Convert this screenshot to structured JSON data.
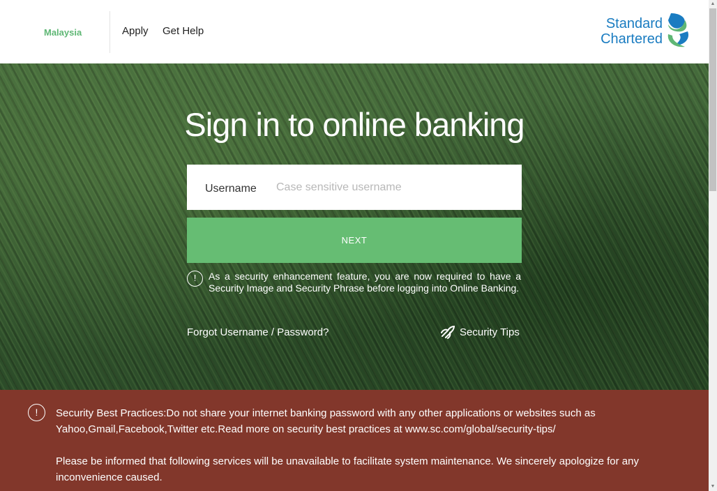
{
  "header": {
    "country": "Malaysia",
    "nav": {
      "apply": "Apply",
      "get_help": "Get Help"
    },
    "logo": {
      "line1": "Standard",
      "line2": "Chartered",
      "icon": "sc-swirl-logo",
      "brand_blue": "#1a7cc1",
      "brand_green": "#5fb775"
    }
  },
  "hero": {
    "title": "Sign in to online banking",
    "username_label": "Username",
    "username_placeholder": "Case sensitive username",
    "username_value": "",
    "next_button": "NEXT",
    "notice": "As a security enhancement feature, you are now required to have a Security Image and Security Phrase before logging into Online Banking.",
    "forgot_link": "Forgot Username / Password?",
    "security_tips": "Security Tips",
    "button_color": "#66bd73"
  },
  "alert": {
    "text1": "Security Best Practices:Do not share your internet banking password with any other applications or websites such as Yahoo,Gmail,Facebook,Twitter etc.Read more on security best practices at www.sc.com/global/security-tips/",
    "text2": "Please be informed that following services will be unavailable to facilitate system maintenance. We sincerely apologize for any inconvenience caused.",
    "background": "#82372b"
  }
}
